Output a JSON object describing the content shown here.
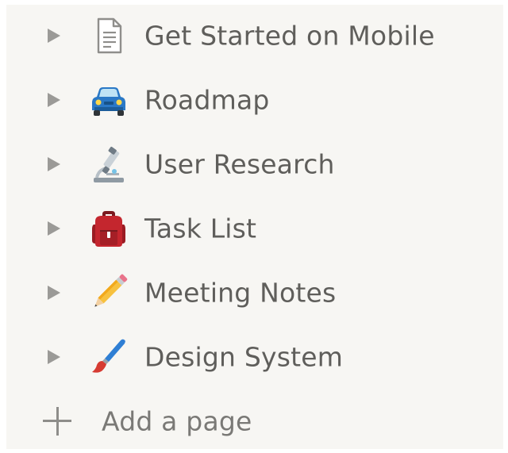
{
  "sidebar": {
    "pages": [
      {
        "title": "Get Started on Mobile",
        "icon": "page-document-icon"
      },
      {
        "title": "Roadmap",
        "icon": "car-icon"
      },
      {
        "title": "User Research",
        "icon": "microscope-icon"
      },
      {
        "title": "Task List",
        "icon": "backpack-icon"
      },
      {
        "title": "Meeting Notes",
        "icon": "pencil-icon"
      },
      {
        "title": "Design System",
        "icon": "paintbrush-icon"
      }
    ],
    "add_page_label": "Add a page"
  },
  "colors": {
    "panel_bg": "#f7f6f3",
    "text": "#5f5e5b",
    "toggle": "#9b9a97"
  }
}
